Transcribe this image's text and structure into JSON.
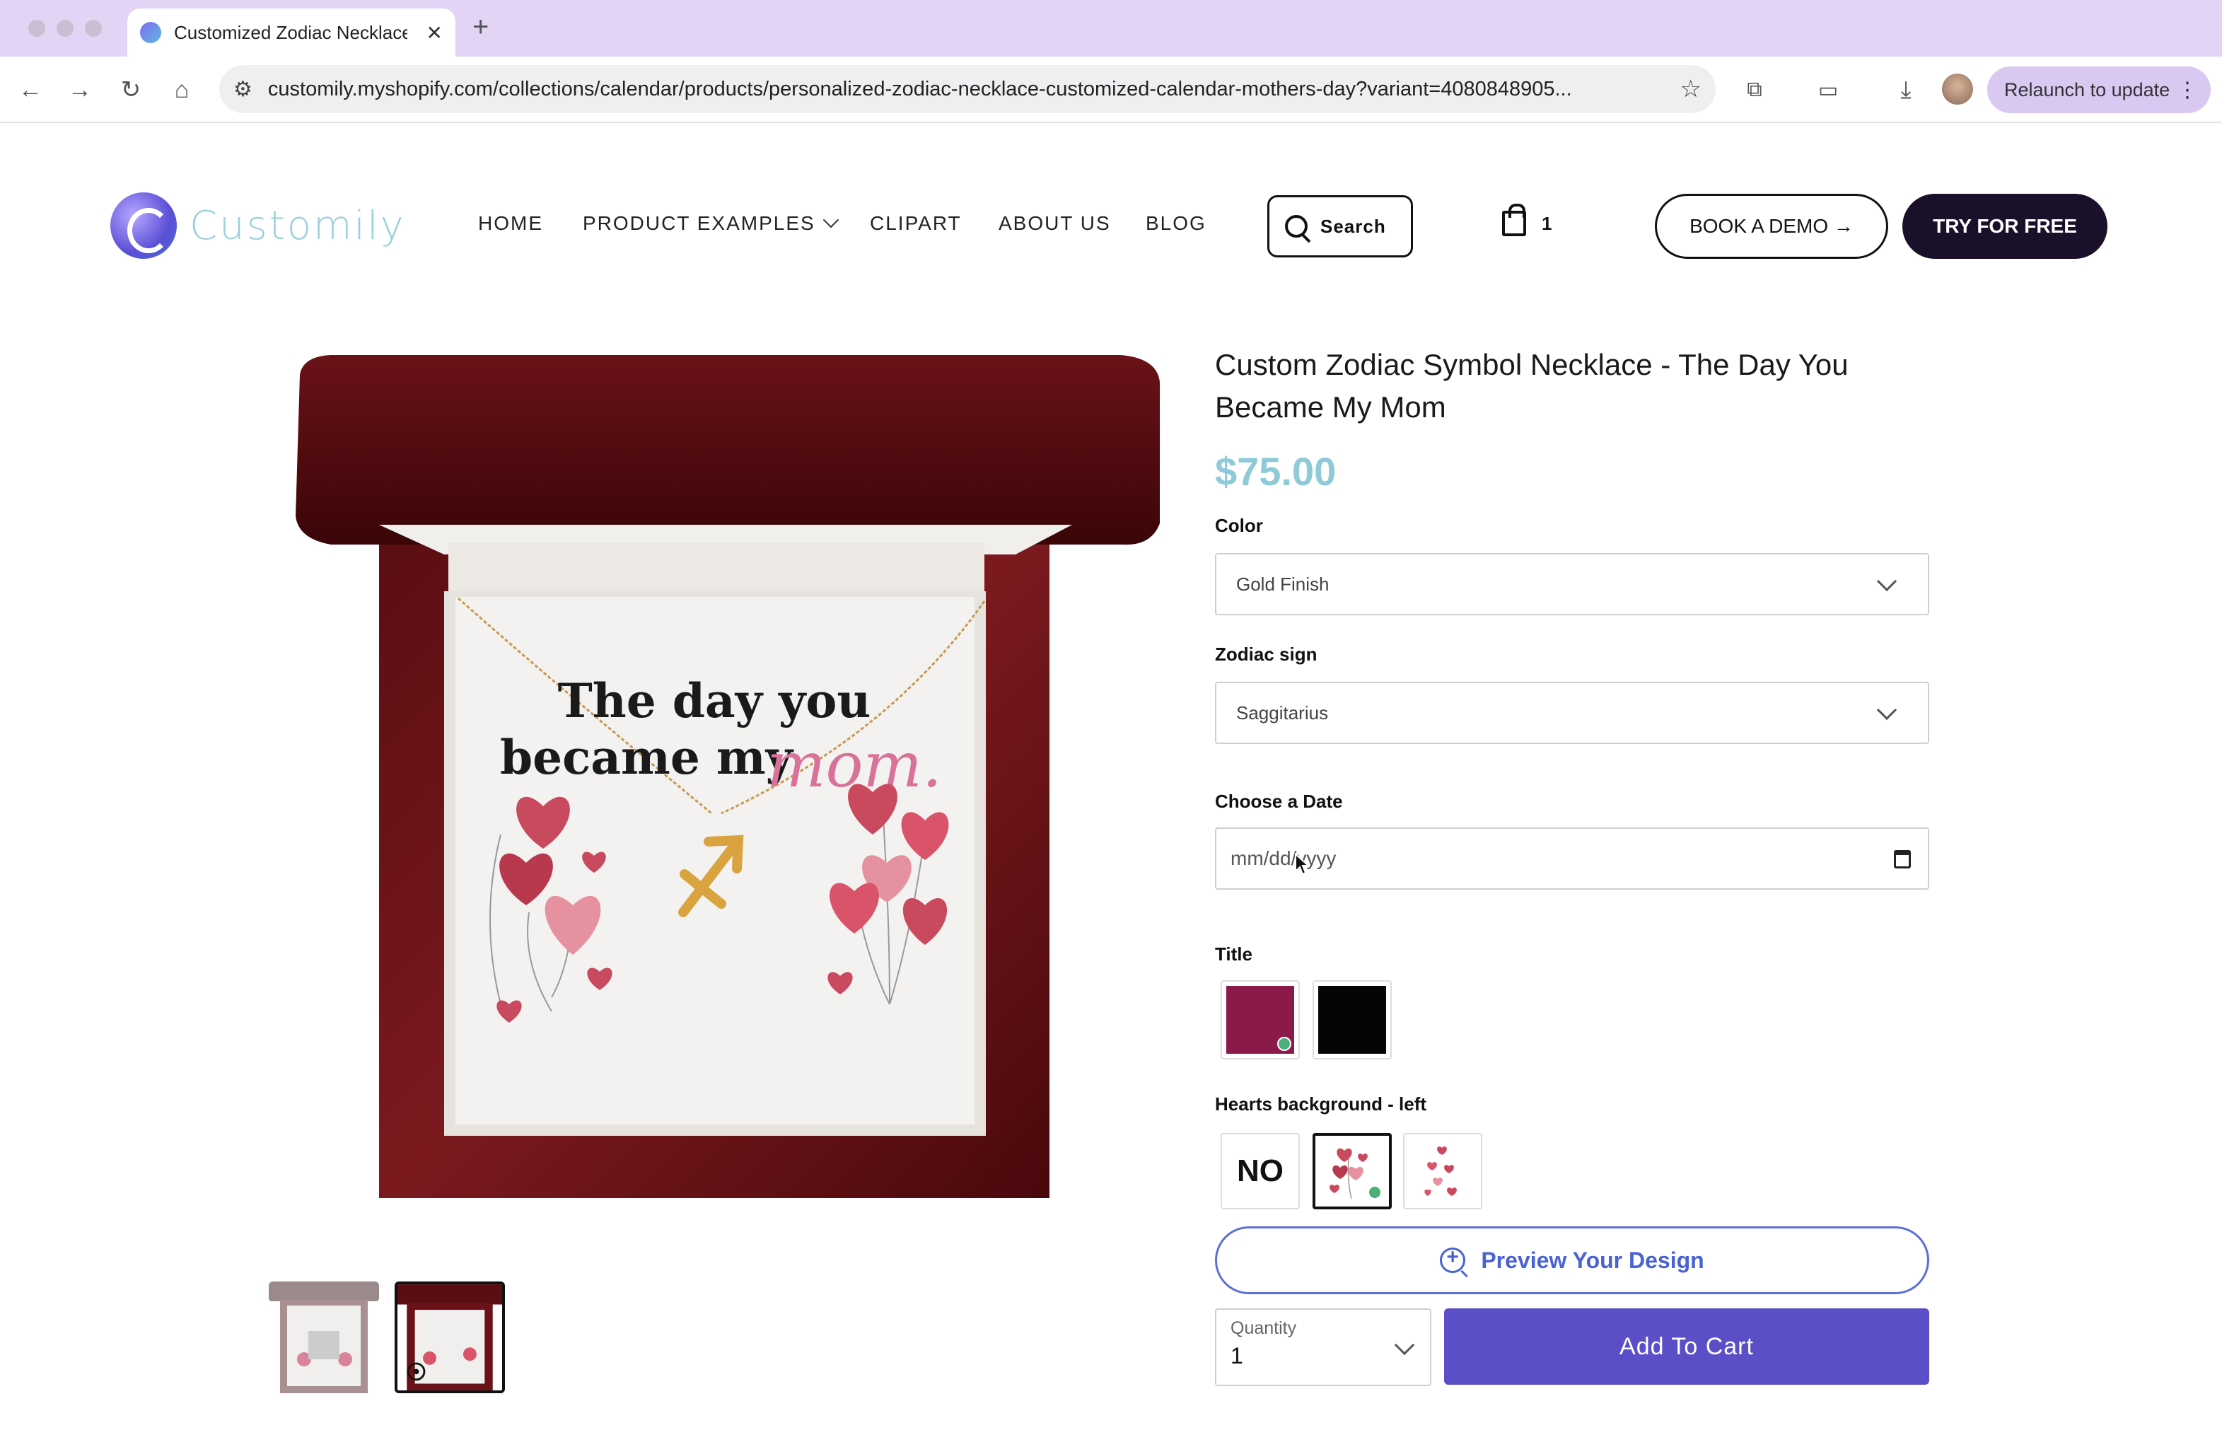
{
  "browser": {
    "tab_title": "Customized Zodiac Necklace",
    "new_tab": "+",
    "url": "customily.myshopify.com/collections/calendar/products/personalized-zodiac-necklace-customized-calendar-mothers-day?variant=4080848905...",
    "relaunch_label": "Relaunch to update"
  },
  "header": {
    "logo_text": "Customily",
    "nav": [
      "HOME",
      "PRODUCT EXAMPLES",
      "CLIPART",
      "ABOUT US",
      "BLOG"
    ],
    "search_label": "Search",
    "cart_count": "1",
    "demo_label": "BOOK A DEMO →",
    "try_label": "TRY FOR FREE"
  },
  "product": {
    "title": "Custom Zodiac Symbol Necklace - The Day You Became My Mom",
    "price": "$75.00",
    "card_text_line1": "The day you",
    "card_text_line2": "became my",
    "card_text_script": "mom."
  },
  "form": {
    "color_label": "Color",
    "color_value": "Gold Finish",
    "zodiac_label": "Zodiac sign",
    "zodiac_value": "Saggitarius",
    "date_label": "Choose a Date",
    "date_placeholder": "mm/dd/yyyy",
    "title_label": "Title",
    "title_swatches": [
      "#8b1a4a",
      "#050505"
    ],
    "hearts_label": "Hearts background - left",
    "hearts_no": "NO",
    "preview_label": "Preview Your Design",
    "quantity_label": "Quantity",
    "quantity_value": "1",
    "add_to_cart": "Add To Cart"
  },
  "colors": {
    "accent": "#5b4fc7",
    "price": "#8fcad8",
    "dark": "#1a1029"
  }
}
